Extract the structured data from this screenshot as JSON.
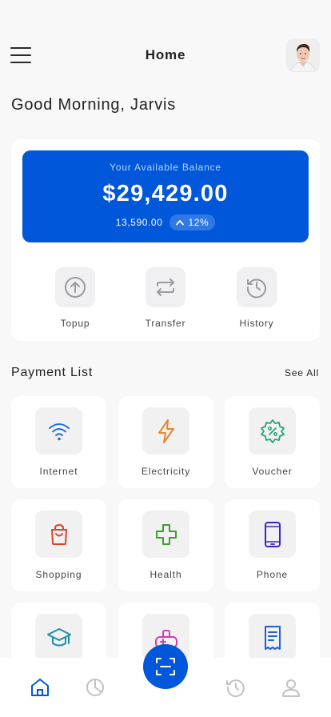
{
  "header": {
    "title": "Home",
    "menu_icon": "hamburger-menu-icon",
    "avatar_icon": "user-avatar"
  },
  "greeting": "Good Morning, Jarvis",
  "balance": {
    "label": "Your Available Balance",
    "amount": "$29,429.00",
    "secondary_amount": "13,590.00",
    "change": "12%",
    "change_icon": "chevron-up-icon",
    "card_color": "#0057d9"
  },
  "actions": [
    {
      "label": "Topup",
      "icon": "arrow-up-circle-icon"
    },
    {
      "label": "Transfer",
      "icon": "transfer-arrows-icon"
    },
    {
      "label": "History",
      "icon": "history-clock-icon"
    }
  ],
  "payments": {
    "title": "Payment List",
    "see_all": "See All",
    "items": [
      {
        "label": "Internet",
        "icon": "wifi-icon",
        "color": "#1e6fd9"
      },
      {
        "label": "Electricity",
        "icon": "lightning-icon",
        "color": "#e8862c"
      },
      {
        "label": "Voucher",
        "icon": "voucher-percent-icon",
        "color": "#1fa47a"
      },
      {
        "label": "Shopping",
        "icon": "shopping-bag-icon",
        "color": "#d9442c"
      },
      {
        "label": "Health",
        "icon": "health-cross-icon",
        "color": "#3aa12a"
      },
      {
        "label": "Phone",
        "icon": "phone-icon",
        "color": "#3b23c9"
      },
      {
        "label": "",
        "icon": "graduation-cap-icon",
        "color": "#1e8fb0"
      },
      {
        "label": "",
        "icon": "game-controller-icon",
        "color": "#d43bb4"
      },
      {
        "label": "",
        "icon": "bill-receipt-icon",
        "color": "#1e5fd9"
      }
    ]
  },
  "bottom_nav": [
    {
      "name": "home",
      "icon": "home-icon",
      "active": true
    },
    {
      "name": "stats",
      "icon": "pie-chart-icon",
      "active": false
    },
    {
      "name": "scan",
      "icon": "scan-icon",
      "active": false
    },
    {
      "name": "history",
      "icon": "history-icon",
      "active": false
    },
    {
      "name": "profile",
      "icon": "user-icon",
      "active": false
    }
  ]
}
